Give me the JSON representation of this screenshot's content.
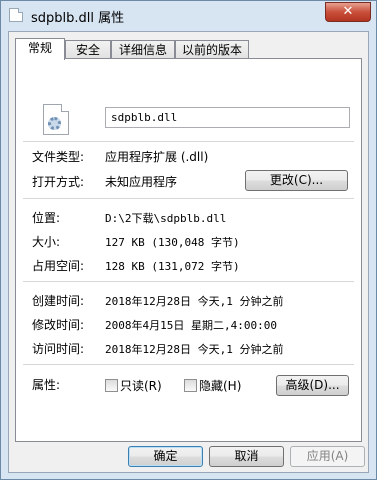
{
  "window": {
    "title": "sdpblb.dll 属性",
    "close_glyph": "✕"
  },
  "tabs": [
    {
      "label": "常规"
    },
    {
      "label": "安全"
    },
    {
      "label": "详细信息"
    },
    {
      "label": "以前的版本"
    }
  ],
  "general": {
    "filename": "sdpblb.dll",
    "file_type_label": "文件类型:",
    "file_type_value": "应用程序扩展 (.dll)",
    "opens_with_label": "打开方式:",
    "opens_with_value": "未知应用程序",
    "change_button": "更改(C)...",
    "location_label": "位置:",
    "location_value": "D:\\2下载\\sdpblb.dll",
    "size_label": "大小:",
    "size_value": "127 KB (130,048 字节)",
    "size_on_disk_label": "占用空间:",
    "size_on_disk_value": "128 KB (131,072 字节)",
    "created_label": "创建时间:",
    "created_value": "2018年12月28日 今天,1 分钟之前",
    "modified_label": "修改时间:",
    "modified_value": "2008年4月15日 星期二,4:00:00",
    "accessed_label": "访问时间:",
    "accessed_value": "2018年12月28日 今天,1 分钟之前",
    "attributes_label": "属性:",
    "readonly_label": "只读(R)",
    "hidden_label": "隐藏(H)",
    "advanced_button": "高级(D)..."
  },
  "footer": {
    "ok": "确定",
    "cancel": "取消",
    "apply": "应用(A)"
  },
  "colors": {
    "title_bar": "#d7e4f2",
    "close_button": "#c9503c",
    "default_button_border": "#3c7fb1"
  },
  "icons": {
    "window_icon": "dll-file-icon",
    "file_icon": "dll-gear-file-icon"
  }
}
